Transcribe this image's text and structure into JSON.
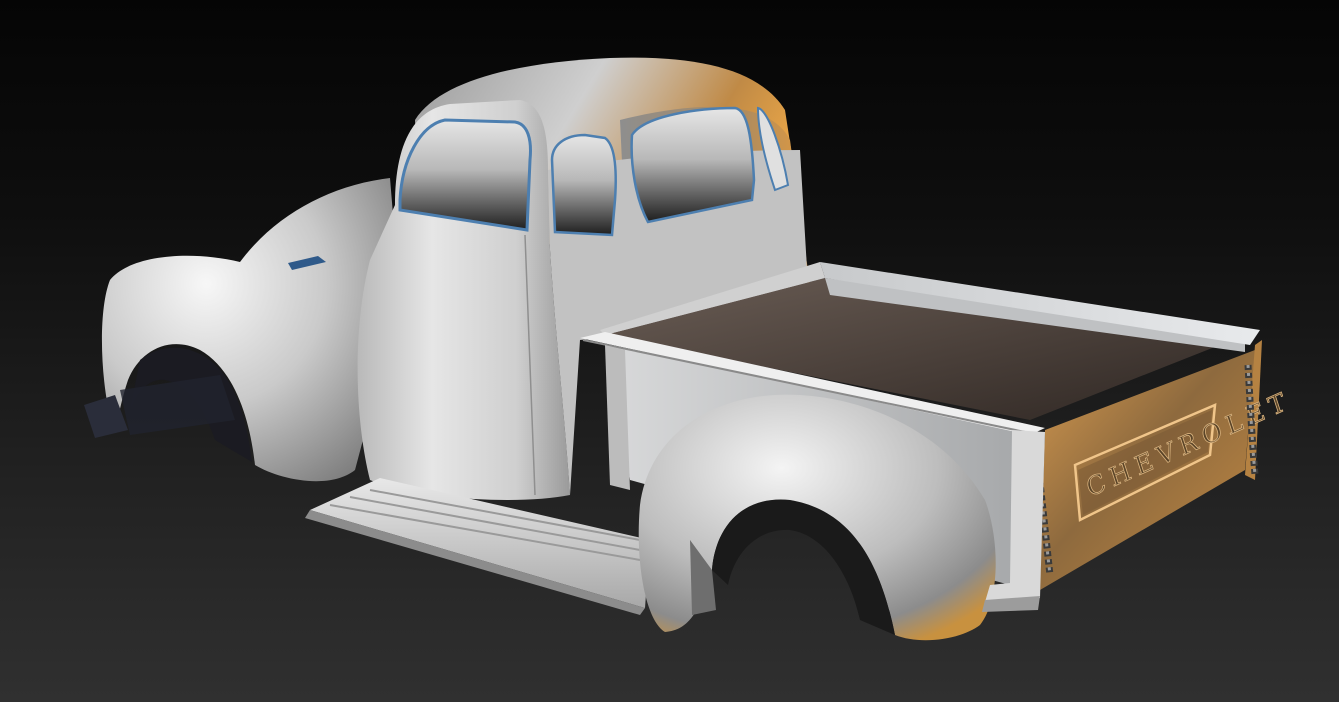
{
  "scene": {
    "subject": "truck-body-render",
    "colors": {
      "background_top": "#050505",
      "background_bottom": "#303030",
      "body": "#c9c9c9",
      "highlight": "#f2f2f2",
      "shadow": "#6d6d6d",
      "warm_reflection": "#e3a248",
      "glass": "#2a2a2a",
      "trim": "#4d7fb0"
    },
    "tailgate_lettering": "CHEVROLET"
  }
}
